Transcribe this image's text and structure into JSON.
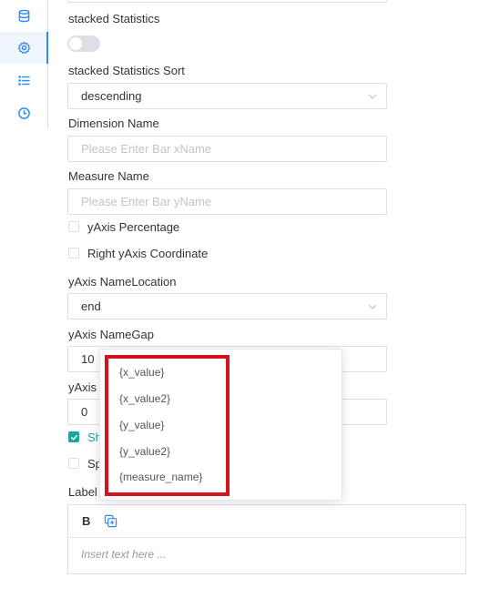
{
  "sidebar": {
    "items": [
      {
        "icon": "database-icon"
      },
      {
        "icon": "gear-icon",
        "active": true
      },
      {
        "icon": "list-icon"
      },
      {
        "icon": "clock-icon"
      }
    ]
  },
  "form": {
    "stacked_statistics_label": "stacked Statistics",
    "stacked_statistics_sort_label": "stacked Statistics Sort",
    "stacked_statistics_sort_value": "descending",
    "dimension_name_label": "Dimension Name",
    "dimension_name_placeholder": "Please Enter Bar xName",
    "measure_name_label": "Measure Name",
    "measure_name_placeholder": "Please Enter Bar yName",
    "yaxis_percentage_label": "yAxis Percentage",
    "right_yaxis_label": "Right yAxis Coordinate",
    "yaxis_namelocation_label": "yAxis NameLocation",
    "yaxis_namelocation_value": "end",
    "yaxis_namegap_label": "yAxis NameGap",
    "yaxis_namegap_value": "10",
    "yaxis_partial_label": "yAxis",
    "yaxis_partial_value": "0",
    "checkbox_checked_partial": "Sh",
    "checkbox_unchecked_partial": "Sp",
    "label_partial": "Label"
  },
  "popup": {
    "items": [
      "{x_value}",
      "{x_value2}",
      "{y_value}",
      "{y_value2}",
      "{measure_name}"
    ]
  },
  "editor": {
    "bold_label": "B",
    "placeholder": "Insert text here ..."
  },
  "colors": {
    "accent": "#16a8a0",
    "highlight": "#d3141c",
    "sidebar_active": "#2d8cf0"
  }
}
